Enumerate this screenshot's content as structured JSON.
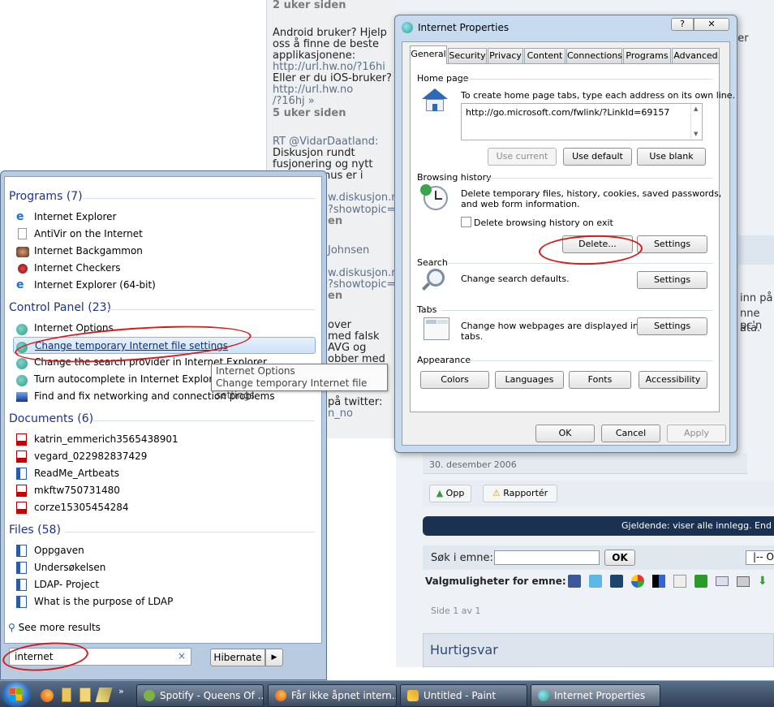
{
  "twitter": {
    "age1": "2 uker siden",
    "t1_lines": [
      "Android bruker? Hjelp",
      "oss å finne de beste",
      "applikasjonene:"
    ],
    "t1_link": "http://url.hw.no/?16hi",
    "t1_more": "Eller er du iOS-bruker?",
    "t1_link2a": "http://url.hw.no",
    "t1_link2b": "/?16hj »",
    "age2": "5 uker siden",
    "t2_handle": "RT @VidarDaatland:",
    "t2_lines": [
      "Diskusjon rundt",
      "fusjonering og nytt",
      "nus er i"
    ],
    "frag_link1a": "w.diskusjon.n",
    "frag_link1b": "?showtopic=",
    "frag_en1": "en",
    "frag_user": "Johnsen",
    "frag_link2a": "w.diskusjon.n",
    "frag_link2b": "?showtopic=",
    "frag_en2": "en",
    "frag_lines": [
      "over",
      "med falsk",
      "AVG og",
      "obber med"
    ],
    "frag_twitter": "på twitter:",
    "frag_handle": "n_no"
  },
  "forum": {
    "right_frag1": "iler",
    "right_frag2": "inn på",
    "right_frag3": "nne pc'n",
    "right_frag4": "ata.",
    "date": "30. desember 2006",
    "up_label": "Opp",
    "report_label": "Rapportér",
    "banner": "Gjeldende: viser alle innlegg. End",
    "search_label": "Søk i emne:",
    "search_value": "",
    "ok_label": "OK",
    "select_frag": "|-- O",
    "options_label": "Valgmuligheter for emne:",
    "page_label": "Side 1 av 1",
    "quick_reply": "Hurtigsvar"
  },
  "start_menu": {
    "programs_header": "Programs (7)",
    "programs": [
      {
        "label": "Internet Explorer",
        "icon": "ie-icon"
      },
      {
        "label": "AntiVir on the Internet",
        "icon": "document-icon"
      },
      {
        "label": "Internet Backgammon",
        "icon": "backgammon-icon"
      },
      {
        "label": "Internet Checkers",
        "icon": "checkers-icon"
      },
      {
        "label": "Internet Explorer (64-bit)",
        "icon": "ie-icon"
      }
    ],
    "control_panel_header": "Control Panel (23)",
    "control_panel": [
      {
        "label": "Internet Options"
      },
      {
        "label": "Change temporary Internet file settings"
      },
      {
        "label": "Change the search provider in Internet Explorer"
      },
      {
        "label": "Turn autocomplete in Internet Explorer on"
      },
      {
        "label": "Find and fix networking and connection problems"
      }
    ],
    "documents_header": "Documents (6)",
    "documents": [
      {
        "label": "katrin_emmerich3565438901"
      },
      {
        "label": "vegard_022982837429"
      },
      {
        "label": "ReadMe_Artbeats"
      },
      {
        "label": "mkftw750731480"
      },
      {
        "label": "corze15305454284"
      }
    ],
    "files_header": "Files (58)",
    "files": [
      {
        "label": "Oppgaven"
      },
      {
        "label": "Undersøkelsen"
      },
      {
        "label": "LDAP- Project"
      },
      {
        "label": "What is the purpose of LDAP"
      }
    ],
    "see_more": "See more results",
    "search_value": "internet",
    "hibernate_label": "Hibernate",
    "tooltip_title": "Internet Options",
    "tooltip_text": "Change temporary Internet file settings"
  },
  "dialog": {
    "title": "Internet Properties",
    "help": "?",
    "tabs": [
      "General",
      "Security",
      "Privacy",
      "Content",
      "Connections",
      "Programs",
      "Advanced"
    ],
    "home_page_group": "Home page",
    "home_page_text": "To create home page tabs, type each address on its own line.",
    "home_page_value": "http://go.microsoft.com/fwlink/?LinkId=69157",
    "use_current": "Use current",
    "use_default": "Use default",
    "use_blank": "Use blank",
    "browsing_group": "Browsing history",
    "browsing_text1": "Delete temporary files, history, cookies, saved passwords,",
    "browsing_text2": "and web form information.",
    "delete_on_exit": "Delete browsing history on exit",
    "delete_label": "Delete...",
    "settings_label": "Settings",
    "search_group": "Search",
    "search_text": "Change search defaults.",
    "tabs_group": "Tabs",
    "tabs_text1": "Change how webpages are displayed in",
    "tabs_text2": "tabs.",
    "appearance_group": "Appearance",
    "colors": "Colors",
    "languages": "Languages",
    "fonts": "Fonts",
    "accessibility": "Accessibility",
    "ok": "OK",
    "cancel": "Cancel",
    "apply": "Apply"
  },
  "taskbar": {
    "items": [
      {
        "label": "Spotify - Queens Of ..."
      },
      {
        "label": "Får ikke åpnet intern..."
      },
      {
        "label": "Untitled - Paint"
      },
      {
        "label": "Internet Properties"
      }
    ]
  },
  "colors": {
    "accent_blue": "#1e3287",
    "annotation_red": "#d11d1d",
    "forum_banner": "#1b3152"
  }
}
